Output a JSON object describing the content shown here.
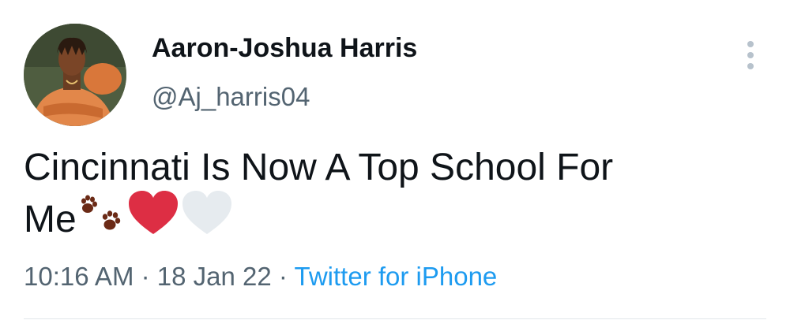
{
  "author": {
    "display_name": "Aaron-Joshua Harris",
    "handle": "@Aj_harris04"
  },
  "tweet": {
    "text_line1": "Cincinnati Is Now A Top School For",
    "text_line2": "Me",
    "emojis": [
      "paw-prints-icon",
      "red-heart-icon",
      "white-heart-icon"
    ]
  },
  "meta": {
    "time": "10:16 AM",
    "separator": "·",
    "date": "18 Jan 22",
    "source": "Twitter for iPhone"
  },
  "colors": {
    "name": "#0f1419",
    "secondary": "#536471",
    "link": "#1d9bf0",
    "paw": "#6b2a16",
    "red_heart": "#dd2e44",
    "white_heart": "#e1e8ed"
  }
}
